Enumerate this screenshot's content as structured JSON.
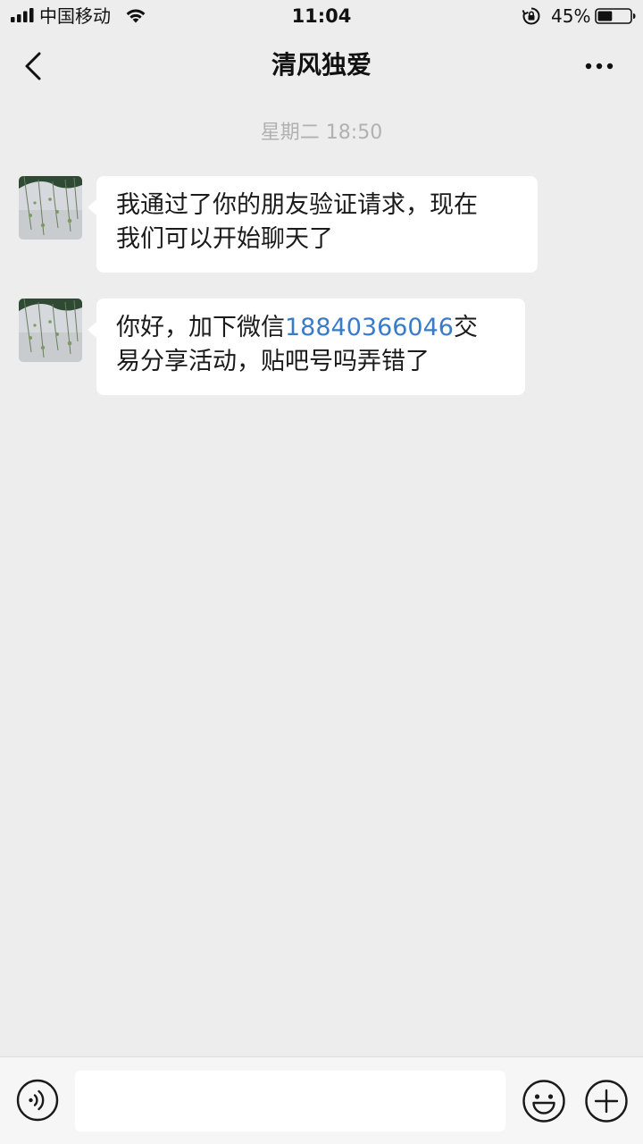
{
  "status_bar": {
    "carrier": "中国移动",
    "time": "11:04",
    "battery_percent": "45%",
    "battery_level": 0.45,
    "icons": [
      "signal-icon",
      "wifi-icon",
      "rotation-lock-icon",
      "battery-icon"
    ]
  },
  "nav": {
    "title": "清风独爱",
    "back_icon": "chevron-left-icon",
    "more_icon": "more-dots-icon"
  },
  "chat": {
    "timestamp": "星期二 18:50",
    "messages": [
      {
        "sender": "清风独爱",
        "line1": "我通过了你的朋友验证请求，现在",
        "line2": "我们可以开始聊天了"
      },
      {
        "sender": "清风独爱",
        "prefix": "你好，加下微信",
        "link": "18840366046",
        "suffix": "交",
        "line2": "易分享活动，贴吧号吗弄错了"
      }
    ]
  },
  "input_bar": {
    "voice_icon": "voice-icon",
    "input_value": "",
    "emoji_icon": "emoji-icon",
    "plus_icon": "plus-icon"
  },
  "colors": {
    "background": "#ededed",
    "bubble": "#ffffff",
    "link": "#3a7bc8",
    "timestamp": "#b1b1b1"
  }
}
